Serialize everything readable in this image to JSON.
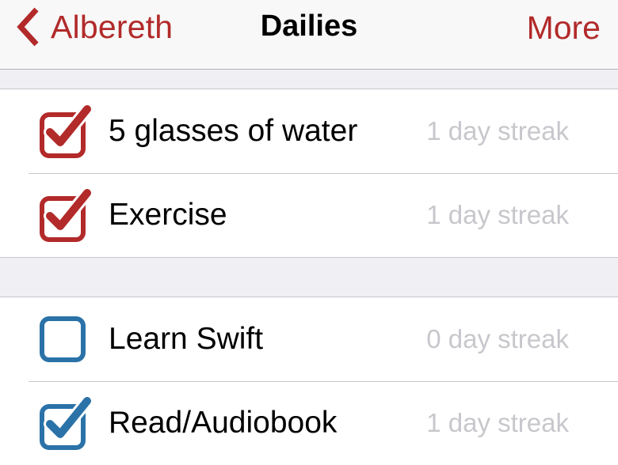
{
  "navbar": {
    "back_label": "Albereth",
    "title": "Dailies",
    "more_label": "More"
  },
  "colors": {
    "accent_red": "#b22a2a",
    "accent_blue": "#2a72a8",
    "streak_gray": "#c7c7cc"
  },
  "sections": [
    {
      "items": [
        {
          "title": "5 glasses of water",
          "streak": "1 day streak",
          "checked": true,
          "color": "red"
        },
        {
          "title": "Exercise",
          "streak": "1 day streak",
          "checked": true,
          "color": "red"
        }
      ]
    },
    {
      "items": [
        {
          "title": "Learn Swift",
          "streak": "0 day streak",
          "checked": false,
          "color": "blue"
        },
        {
          "title": "Read/Audiobook",
          "streak": "1 day streak",
          "checked": true,
          "color": "blue"
        }
      ]
    }
  ]
}
